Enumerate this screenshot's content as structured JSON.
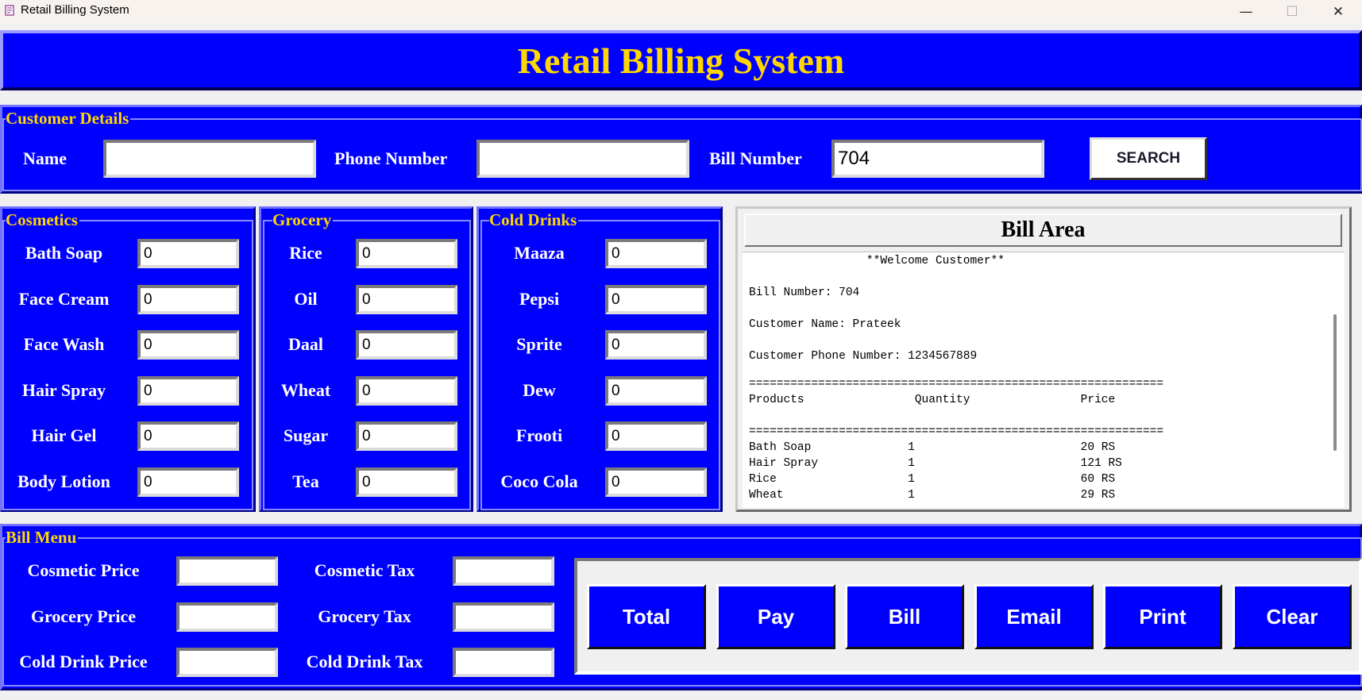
{
  "window": {
    "title": "Retail Billing System",
    "icon": "app-icon",
    "minimize_glyph": "—",
    "maximize_glyph": "☐",
    "close_glyph": "✕"
  },
  "header": {
    "title": "Retail Billing System"
  },
  "customer": {
    "legend": "Customer Details",
    "name_label": "Name",
    "name_value": "",
    "phone_label": "Phone Number",
    "phone_value": "",
    "bill_label": "Bill Number",
    "bill_value": "704",
    "search_label": "SEARCH"
  },
  "cosmetics": {
    "legend": "Cosmetics",
    "items": [
      {
        "label": "Bath Soap",
        "value": "0"
      },
      {
        "label": "Face Cream",
        "value": "0"
      },
      {
        "label": "Face Wash",
        "value": "0"
      },
      {
        "label": "Hair Spray",
        "value": "0"
      },
      {
        "label": "Hair Gel",
        "value": "0"
      },
      {
        "label": "Body Lotion",
        "value": "0"
      }
    ]
  },
  "grocery": {
    "legend": "Grocery",
    "items": [
      {
        "label": "Rice",
        "value": "0"
      },
      {
        "label": "Oil",
        "value": "0"
      },
      {
        "label": "Daal",
        "value": "0"
      },
      {
        "label": "Wheat",
        "value": "0"
      },
      {
        "label": "Sugar",
        "value": "0"
      },
      {
        "label": "Tea",
        "value": "0"
      }
    ]
  },
  "cold_drinks": {
    "legend": "Cold Drinks",
    "items": [
      {
        "label": "Maaza",
        "value": "0"
      },
      {
        "label": "Pepsi",
        "value": "0"
      },
      {
        "label": "Sprite",
        "value": "0"
      },
      {
        "label": "Dew",
        "value": "0"
      },
      {
        "label": "Frooti",
        "value": "0"
      },
      {
        "label": "Coco Cola",
        "value": "0"
      }
    ]
  },
  "bill_area": {
    "title": "Bill Area",
    "lines": [
      "                 **Welcome Customer**",
      "",
      "Bill Number: 704",
      "",
      "Customer Name: Prateek",
      "",
      "Customer Phone Number: 1234567889",
      "",
      "============================================================",
      "Products                Quantity                Price",
      "",
      "============================================================",
      "Bath Soap              1                        20 RS",
      "Hair Spray             1                        121 RS",
      "Rice                   1                        60 RS",
      "Wheat                  1                        29 RS"
    ]
  },
  "bill_menu": {
    "legend": "Bill Menu",
    "fields": [
      {
        "label": "Cosmetic Price",
        "value": ""
      },
      {
        "label": "Grocery Price",
        "value": ""
      },
      {
        "label": "Cold Drink Price",
        "value": ""
      },
      {
        "label": "Cosmetic Tax",
        "value": ""
      },
      {
        "label": "Grocery Tax",
        "value": ""
      },
      {
        "label": "Cold Drink Tax",
        "value": ""
      }
    ],
    "buttons": [
      "Total",
      "Pay",
      "Bill",
      "Email",
      "Print",
      "Clear"
    ]
  },
  "colors": {
    "panel_blue": "#0000ff",
    "title_gold": "#ffd700",
    "label_white": "#ffffff"
  }
}
